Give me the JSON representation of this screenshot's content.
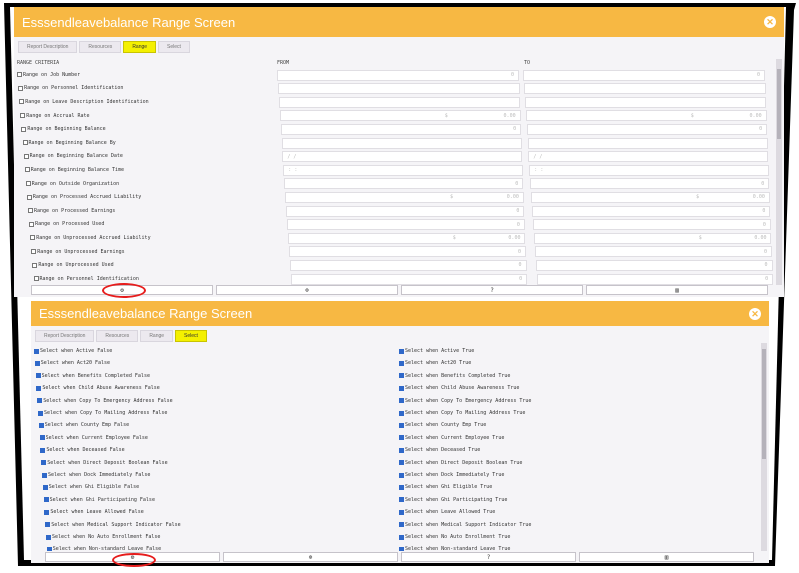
{
  "top_panel": {
    "title": "Esssendleavebalance Range Screen",
    "tabs": [
      "Report Description",
      "Resources",
      "Range",
      "Select"
    ],
    "active_tab": 2,
    "headers": {
      "criteria": "RANGE CRITERIA",
      "from": "FROM",
      "to": "TO"
    },
    "rows": [
      {
        "label": "Range on Job Number",
        "from": "0",
        "to": "0"
      },
      {
        "label": "Range on Personnel Identification",
        "from": "",
        "to": ""
      },
      {
        "label": "Range on Leave Description Identification",
        "from": "",
        "to": ""
      },
      {
        "label": "Range on Accrual Rate",
        "from": "0.00",
        "to": "0.00",
        "prefix": "$"
      },
      {
        "label": "Range on Beginning Balance",
        "from": "0",
        "to": "0"
      },
      {
        "label": "Range on Beginning Balance By",
        "from": "",
        "to": ""
      },
      {
        "label": "Range on Beginning Balance Date",
        "from": "/ /",
        "to": "/ /",
        "left": true
      },
      {
        "label": "Range on Beginning Balance Time",
        "from": ": :",
        "to": ": :",
        "left": true
      },
      {
        "label": "Range on Outside Organization",
        "from": "0",
        "to": "0"
      },
      {
        "label": "Range on Processed Accrued Liability",
        "from": "0.00",
        "to": "0.00",
        "prefix": "$"
      },
      {
        "label": "Range on Processed Earnings",
        "from": "0",
        "to": "0"
      },
      {
        "label": "Range on Processed Used",
        "from": "0",
        "to": "0"
      },
      {
        "label": "Range on Unprocessed Accrued Liability",
        "from": "0.00",
        "to": "0.00",
        "prefix": "$"
      },
      {
        "label": "Range on Unprocessed Earnings",
        "from": "0",
        "to": "0"
      },
      {
        "label": "Range on Unprocessed Used",
        "from": "0",
        "to": "0"
      },
      {
        "label": "Range on Personnel Identification",
        "from": "0",
        "to": "0"
      }
    ],
    "buttons": [
      "gear-icon",
      "close-circle-icon",
      "help-icon",
      "chart-icon"
    ]
  },
  "bottom_panel": {
    "title": "Esssendleavebalance Range Screen",
    "tabs": [
      "Report Description",
      "Resources",
      "Range",
      "Select"
    ],
    "active_tab": 3,
    "left_items": [
      "Select when Active False",
      "Select when Act20 False",
      "Select when Benefits Completed False",
      "Select when Child Abuse Awareness False",
      "Select when Copy To Emergency Address False",
      "Select when Copy To Mailing Address False",
      "Select when County Emp False",
      "Select when Current Employee False",
      "Select when Deceased False",
      "Select when Direct Deposit Boolean False",
      "Select when Dock Immediately False",
      "Select when Ghi Eligible False",
      "Select when Ghi Participating False",
      "Select when Leave Allowed False",
      "Select when Medical Support Indicator False",
      "Select when No Auto Enrollment False",
      "Select when Non-standard Leave False"
    ],
    "right_items": [
      "Select when Active True",
      "Select when Act20 True",
      "Select when Benefits Completed True",
      "Select when Child Abuse Awareness True",
      "Select when Copy To Emergency Address True",
      "Select when Copy To Mailing Address True",
      "Select when County Emp True",
      "Select when Current Employee True",
      "Select when Deceased True",
      "Select when Direct Deposit Boolean True",
      "Select when Dock Immediately True",
      "Select when Ghi Eligible True",
      "Select when Ghi Participating True",
      "Select when Leave Allowed True",
      "Select when Medical Support Indicator True",
      "Select when No Auto Enrollment True",
      "Select when Non-standard Leave True"
    ],
    "buttons": [
      "gear-icon",
      "close-circle-icon",
      "help-icon",
      "chart-icon"
    ]
  },
  "colors": {
    "header": "#f7b843",
    "active_tab": "#f4f000",
    "checkbox": "#2f68c9",
    "highlight": "#e61c1c"
  }
}
